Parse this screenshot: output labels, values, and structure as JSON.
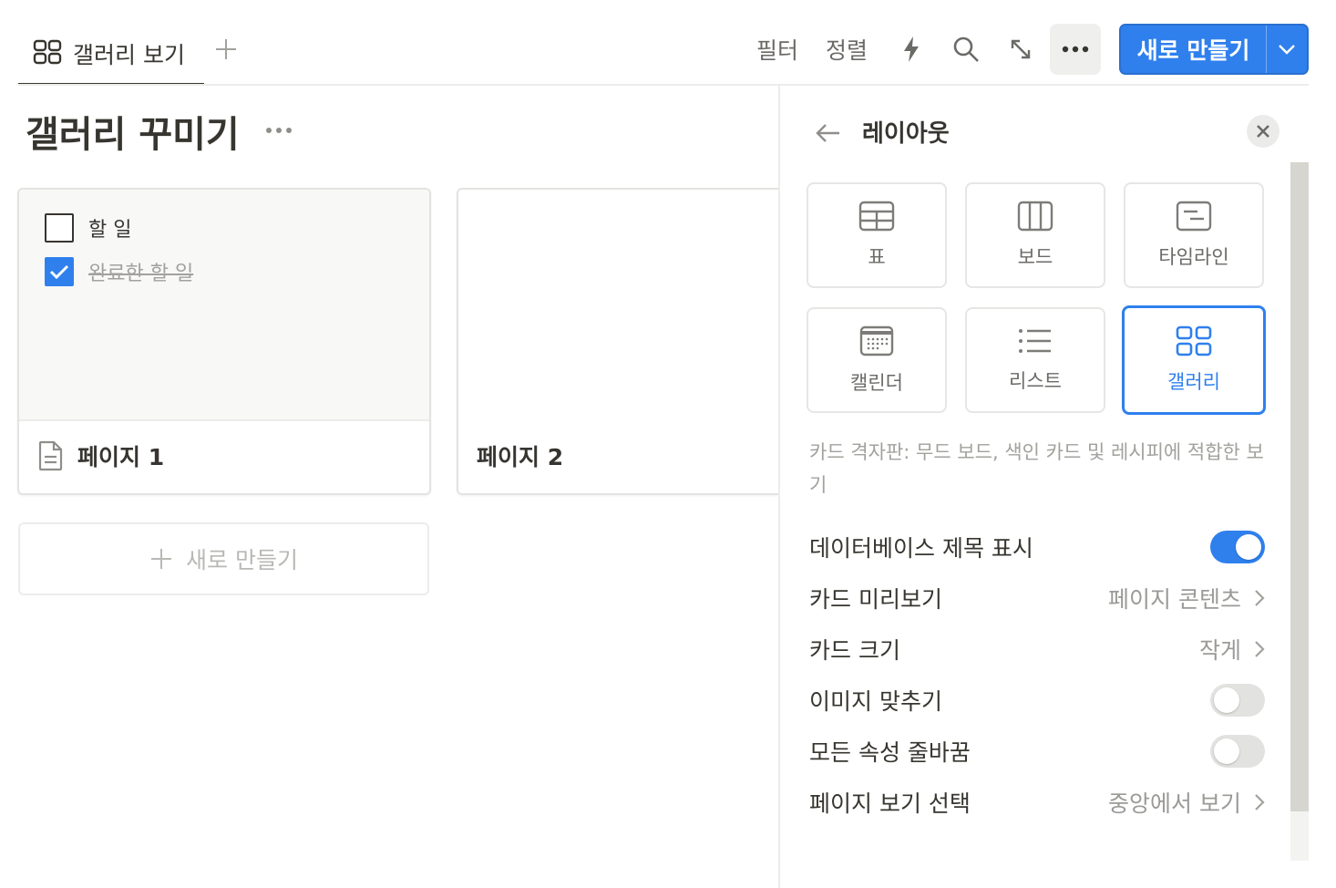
{
  "toolbar": {
    "tab_label": "갤러리 보기",
    "filter": "필터",
    "sort": "정렬",
    "new_button": "새로 만들기"
  },
  "page": {
    "title": "갤러리 꾸미기"
  },
  "cards": [
    {
      "title": "페이지 1",
      "todos": [
        {
          "text": "할 일",
          "checked": false
        },
        {
          "text": "완료한 할 일",
          "checked": true
        }
      ]
    },
    {
      "title": "페이지 2"
    }
  ],
  "new_card_label": "새로 만들기",
  "panel": {
    "title": "레이아웃",
    "layouts": [
      {
        "label": "표",
        "icon": "table-icon"
      },
      {
        "label": "보드",
        "icon": "board-icon"
      },
      {
        "label": "타임라인",
        "icon": "timeline-icon"
      },
      {
        "label": "캘린더",
        "icon": "calendar-icon"
      },
      {
        "label": "리스트",
        "icon": "list-icon"
      },
      {
        "label": "갤러리",
        "icon": "gallery-icon",
        "selected": true
      }
    ],
    "description": "카드 격자판: 무드 보드, 색인 카드 및 레시피에 적합한 보기",
    "settings": [
      {
        "label": "데이터베이스 제목 표시",
        "toggle": true
      },
      {
        "label": "카드 미리보기",
        "value": "페이지 콘텐츠"
      },
      {
        "label": "카드 크기",
        "value": "작게"
      },
      {
        "label": "이미지 맞추기",
        "toggle": false
      },
      {
        "label": "모든 속성 줄바꿈",
        "toggle": false
      },
      {
        "label": "페이지 보기 선택",
        "value": "중앙에서 보기"
      }
    ]
  },
  "colors": {
    "accent": "#2f80ed",
    "text": "#37352f",
    "muted": "#9b9a97"
  }
}
